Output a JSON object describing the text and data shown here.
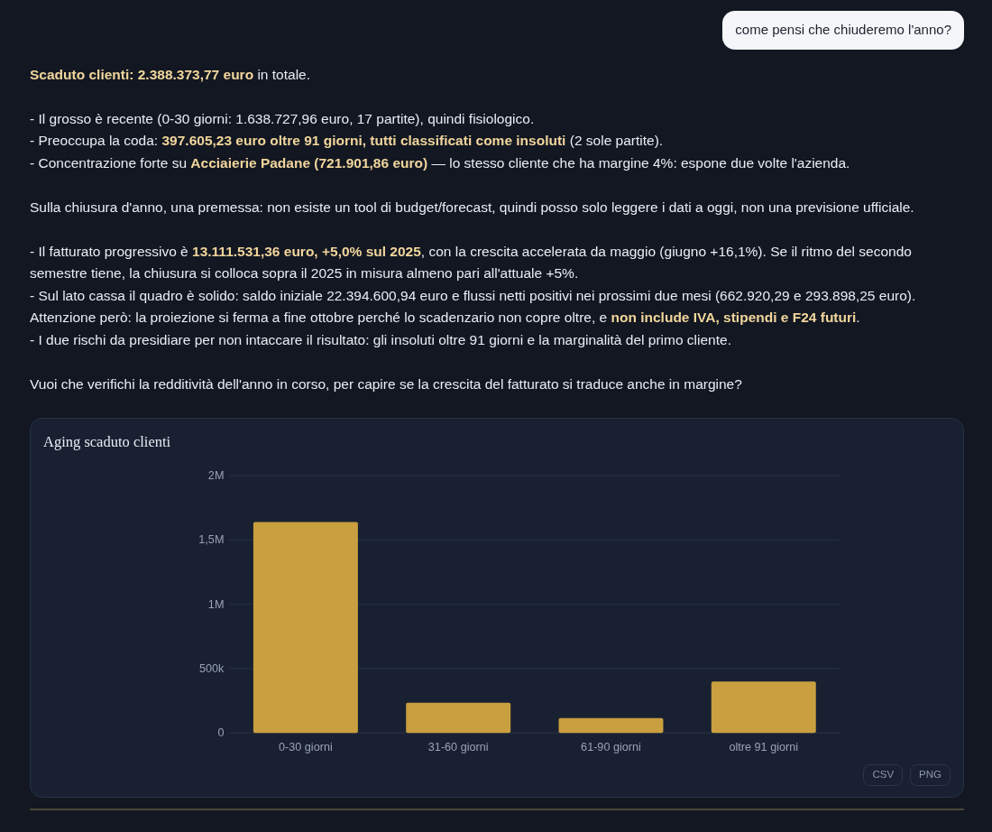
{
  "user_message": {
    "text": "come pensi che chiuderemo l'anno?"
  },
  "reply": {
    "paragraphs": [
      [
        "**Scaduto clienti: 2.388.373,77 euro** in totale."
      ],
      [
        "- Il grosso è recente (0-30 giorni: 1.638.727,96 euro, 17 partite), quindi fisiologico.",
        "- Preoccupa la coda: **397.605,23 euro oltre 91 giorni, tutti classificati come insoluti** (2 sole partite).",
        "- Concentrazione forte su **Acciaierie Padane (721.901,86 euro)** — lo stesso cliente che ha margine 4%: espone due volte l'azienda."
      ],
      [
        "Sulla chiusura d'anno, una premessa: non esiste un tool di budget/forecast, quindi posso solo leggere i dati a oggi, non una previsione ufficiale."
      ],
      [
        "- Il fatturato progressivo è **13.111.531,36 euro, +5,0% sul 2025**, con la crescita accelerata da maggio (giugno +16,1%). Se il ritmo del secondo semestre tiene, la chiusura si colloca sopra il 2025 in misura almeno pari all'attuale +5%.",
        "- Sul lato cassa il quadro è solido: saldo iniziale 22.394.600,94 euro e flussi netti positivi nei prossimi due mesi (662.920,29 e 293.898,25 euro). Attenzione però: la proiezione si ferma a fine ottobre perché lo scadenzario non copre oltre, e **non include IVA, stipendi e F24 futuri**.",
        "- I due rischi da presidiare per non intaccare il risultato: gli insoluti oltre 91 giorni e la marginalità del primo cliente."
      ],
      [
        "Vuoi che verifichi la redditività dell'anno in corso, per capire se la crescita del fatturato si traduce anche in margine?"
      ]
    ]
  },
  "chart_card": {
    "title": "Aging scaduto clienti",
    "chart_data": {
      "type": "bar",
      "categories": [
        "0-30 giorni",
        "31-60 giorni",
        "61-90 giorni",
        "oltre 91 giorni"
      ],
      "series": [
        {
          "color": "#c99f3f",
          "values": [
            1640000,
            235000,
            115000,
            400000
          ]
        }
      ],
      "grid": true,
      "ylim": [
        0,
        2000000
      ],
      "yticks": [
        {
          "value": 0,
          "label": "0"
        },
        {
          "value": 500000,
          "label": "500k"
        },
        {
          "value": 1000000,
          "label": "1M"
        },
        {
          "value": 1500000,
          "label": "1,5M"
        },
        {
          "value": 2000000,
          "label": "2M"
        }
      ]
    },
    "buttons": [
      "CSV",
      "PNG"
    ]
  }
}
